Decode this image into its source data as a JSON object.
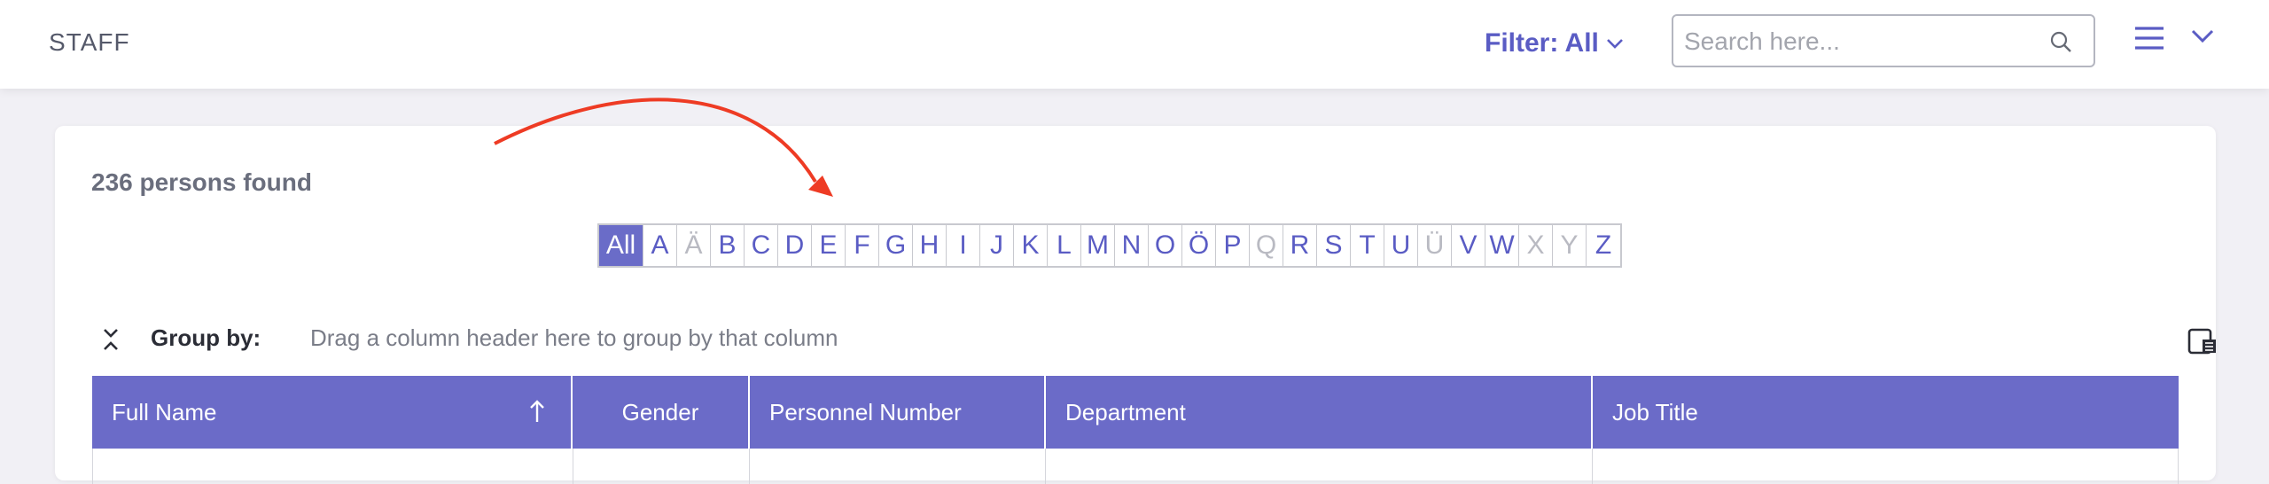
{
  "header": {
    "title": "STAFF",
    "filter_label": "Filter: All",
    "search_placeholder": "Search here..."
  },
  "results": {
    "count_text": "236 persons found"
  },
  "alphabet": [
    {
      "label": "All",
      "active": true,
      "enabled": true
    },
    {
      "label": "A",
      "enabled": true
    },
    {
      "label": "Ä",
      "enabled": false
    },
    {
      "label": "B",
      "enabled": true
    },
    {
      "label": "C",
      "enabled": true
    },
    {
      "label": "D",
      "enabled": true
    },
    {
      "label": "E",
      "enabled": true
    },
    {
      "label": "F",
      "enabled": true
    },
    {
      "label": "G",
      "enabled": true
    },
    {
      "label": "H",
      "enabled": true
    },
    {
      "label": "I",
      "enabled": true
    },
    {
      "label": "J",
      "enabled": true
    },
    {
      "label": "K",
      "enabled": true
    },
    {
      "label": "L",
      "enabled": true
    },
    {
      "label": "M",
      "enabled": true
    },
    {
      "label": "N",
      "enabled": true
    },
    {
      "label": "O",
      "enabled": true
    },
    {
      "label": "Ö",
      "enabled": true
    },
    {
      "label": "P",
      "enabled": true
    },
    {
      "label": "Q",
      "enabled": false
    },
    {
      "label": "R",
      "enabled": true
    },
    {
      "label": "S",
      "enabled": true
    },
    {
      "label": "T",
      "enabled": true
    },
    {
      "label": "U",
      "enabled": true
    },
    {
      "label": "Ü",
      "enabled": false
    },
    {
      "label": "V",
      "enabled": true
    },
    {
      "label": "W",
      "enabled": true
    },
    {
      "label": "X",
      "enabled": false
    },
    {
      "label": "Y",
      "enabled": false
    },
    {
      "label": "Z",
      "enabled": true
    }
  ],
  "group_bar": {
    "label": "Group by:",
    "hint": "Drag a column header here to group by that column"
  },
  "grid": {
    "columns": [
      {
        "label": "Full Name",
        "sort": "ascending"
      },
      {
        "label": "Gender"
      },
      {
        "label": "Personnel Number"
      },
      {
        "label": "Department"
      },
      {
        "label": "Job Title"
      }
    ]
  },
  "colors": {
    "accent": "#6b6bc8",
    "link": "#5a5cc4",
    "annotation_arrow": "#ee3b24"
  },
  "icons": {
    "search": "search-icon",
    "menu": "hamburger-menu-icon",
    "dropdown": "chevron-down-icon",
    "collapse": "collapse-expand-icon",
    "column_chooser": "column-chooser-icon",
    "sort": "sort-ascending-icon"
  }
}
